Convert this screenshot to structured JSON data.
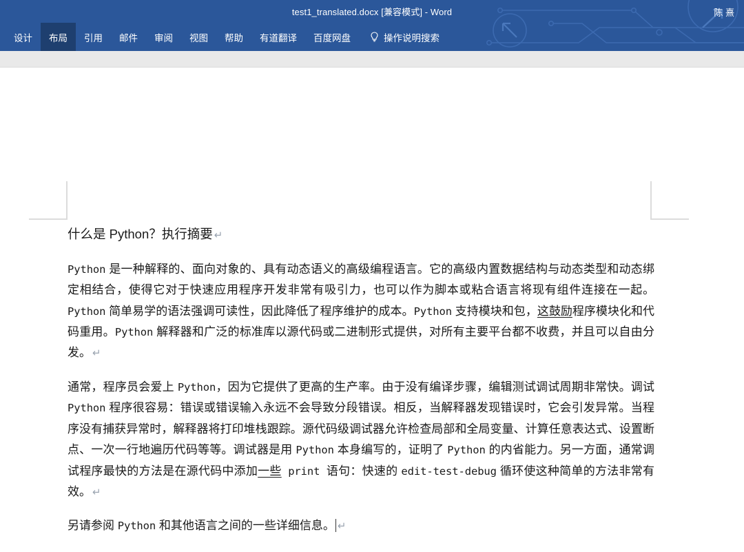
{
  "window": {
    "title": "test1_translated.docx [兼容模式]  -  Word",
    "account_name": "陈 熹",
    "accent_color": "#2b579a",
    "active_tab_color": "#1e3f6f"
  },
  "ribbon": {
    "tabs": [
      {
        "label": "设计",
        "active": false
      },
      {
        "label": "布局",
        "active": true
      },
      {
        "label": "引用",
        "active": false
      },
      {
        "label": "邮件",
        "active": false
      },
      {
        "label": "审阅",
        "active": false
      },
      {
        "label": "视图",
        "active": false
      },
      {
        "label": "帮助",
        "active": false
      },
      {
        "label": "有道翻译",
        "active": false
      },
      {
        "label": "百度网盘",
        "active": false
      }
    ],
    "tell_me": {
      "icon": "lightbulb-icon",
      "label": "操作说明搜索"
    }
  },
  "document": {
    "heading": "什么是 Python？执行摘要",
    "paragraph1": {
      "seg1_mono": "Python",
      "seg2": " 是一种解释的、面向对象的、具有动态语义的高级编程语言。它的高级内置数据结构与动态类型和动态绑定相结合，使得它对于快速应用程序开发非常有吸引力，也可以作为脚本或粘合语言将现有组件连接在一起。",
      "seg3_mono": "Python",
      "seg4": " 简单易学的语法强调可读性，因此降低了程序维护的成本。",
      "seg5_mono": "Python",
      "seg6": " 支持模块和包，",
      "seg7_underline": "这鼓励",
      "seg8": "程序模块化和代码重用。",
      "seg9_mono": "Python",
      "seg10": " 解释器和广泛的标准库以源代码或二进制形式提供，对所有主要平台都不收费，并且可以自由分发。"
    },
    "paragraph2": {
      "seg1": "通常，程序员会爱上 ",
      "seg2_mono": "Python",
      "seg3": "，因为它提供了更高的生产率。由于没有编译步骤，编辑测试调试周期非常快。调试 ",
      "seg4_mono": "Python",
      "seg5": " 程序很容易：错误或错误输入永远不会导致分段错误。相反，当解释器发现错误时，它会引发异常。当程序没有捕获异常时，解释器将打印堆栈跟踪。源代码级调试器允许检查局部和全局变量、计算任意表达式、设置断点、一次一行地遍历代码等等。调试器是用 ",
      "seg6_mono": "Python",
      "seg7": " 本身编写的，证明了 ",
      "seg8_mono": "Python",
      "seg9": " 的内省能力。另一方面，通常调试程序最快的方法是在源代码中添加",
      "seg10_underline": "一些",
      "seg11_mono": " print ",
      "seg12": "语句：快速的 ",
      "seg13_mono": "edit-test-debug",
      "seg14": " 循环使这种简单的方法非常有效。"
    },
    "paragraph3": {
      "seg1": "另请参阅 ",
      "seg2_mono": "Python",
      "seg3": " 和其他语言之间的一些详细信息。"
    },
    "pilcrow_glyph": "↵"
  }
}
